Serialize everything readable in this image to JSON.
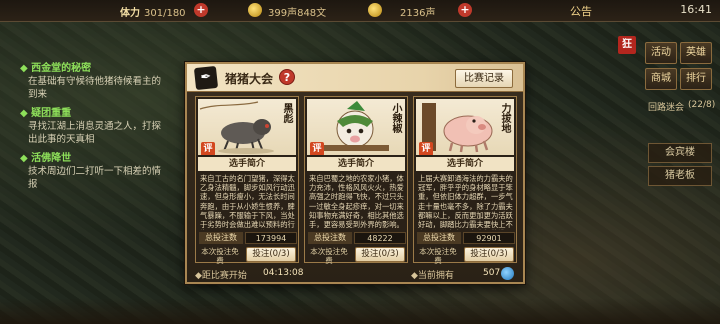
{
  "topbar": {
    "stat1_label": "体力",
    "stat1_value": "301/180",
    "stat2_value": "399声848文",
    "stat3_value": "2136声",
    "announce": "公告",
    "clock": "16:41"
  },
  "quests": [
    {
      "title": "◆ 西金堂的秘密",
      "desc": "在基础有守候待他猪待候看主的到来"
    },
    {
      "title": "◆ 疑团重重",
      "desc": "寻找江湖上消息灵通之人，打探出此事的天真相"
    },
    {
      "title": "◆ 活佛降世",
      "desc": "技术周边们二打听一下相差的情报"
    }
  ],
  "right_panel": {
    "btn_activity": "活动",
    "btn_ranking": "英雄",
    "btn_shop": "商城",
    "btn_ranklist": "排行",
    "red_badge": "狂",
    "alliance_label": "回路迷会",
    "alliance_level": "(22/8)",
    "item1": "会宾楼",
    "item2": "猪老板"
  },
  "modal": {
    "title": "猪猪大会",
    "record_button": "比赛记录",
    "countdown_label": "◆距比赛开始",
    "countdown_value": "04:13:08",
    "own_label": "◆当前拥有",
    "own_value": "507",
    "cards": [
      {
        "name": "黑彪",
        "badge": "评",
        "intro_title": "选手简介",
        "intro": "来自工古的名门望猪，深得太乙身法精髓，脚步如风行动迅速，但身形瘦小，无法长时间奔跑，由于从小娇生惯养，脾气暴躁，不服输于下风，当处于劣势时会做出难以预料的行为。",
        "vote_label": "总投注数",
        "vote_count": "173994",
        "free_label": "本次投注免费",
        "vote_button": "投注(0/3)"
      },
      {
        "name": "小辣椒",
        "badge": "评",
        "intro_title": "选手简介",
        "intro": "来自巴蜀之地的农家小猪，体力充沛，性格风风火火，热爱高强之时跑得飞快，不过只头一过敏全身起疹痒，对一切来知事物充满好奇，相比其他选手，更容易受到外界的影响。",
        "vote_label": "总投注数",
        "vote_count": "48222",
        "free_label": "本次投注免费",
        "vote_button": "投注(0/3)"
      },
      {
        "name": "力拔地",
        "badge": "评",
        "intro_title": "选手简介",
        "intro": "上届大赛卸通海法的力霸夫的冠军，胖乎乎的身材略显于笨重，但依旧体力超群，一步气走十量也毫不多，除了力霸夫都嘛以上，反而更加更为活跃好动，脚踏比力霸夫要快上不少，是个实力不容小觑的选手。",
        "vote_label": "总投注数",
        "vote_count": "92901",
        "free_label": "本次投注免费",
        "vote_button": "投注(0/3)"
      }
    ]
  }
}
